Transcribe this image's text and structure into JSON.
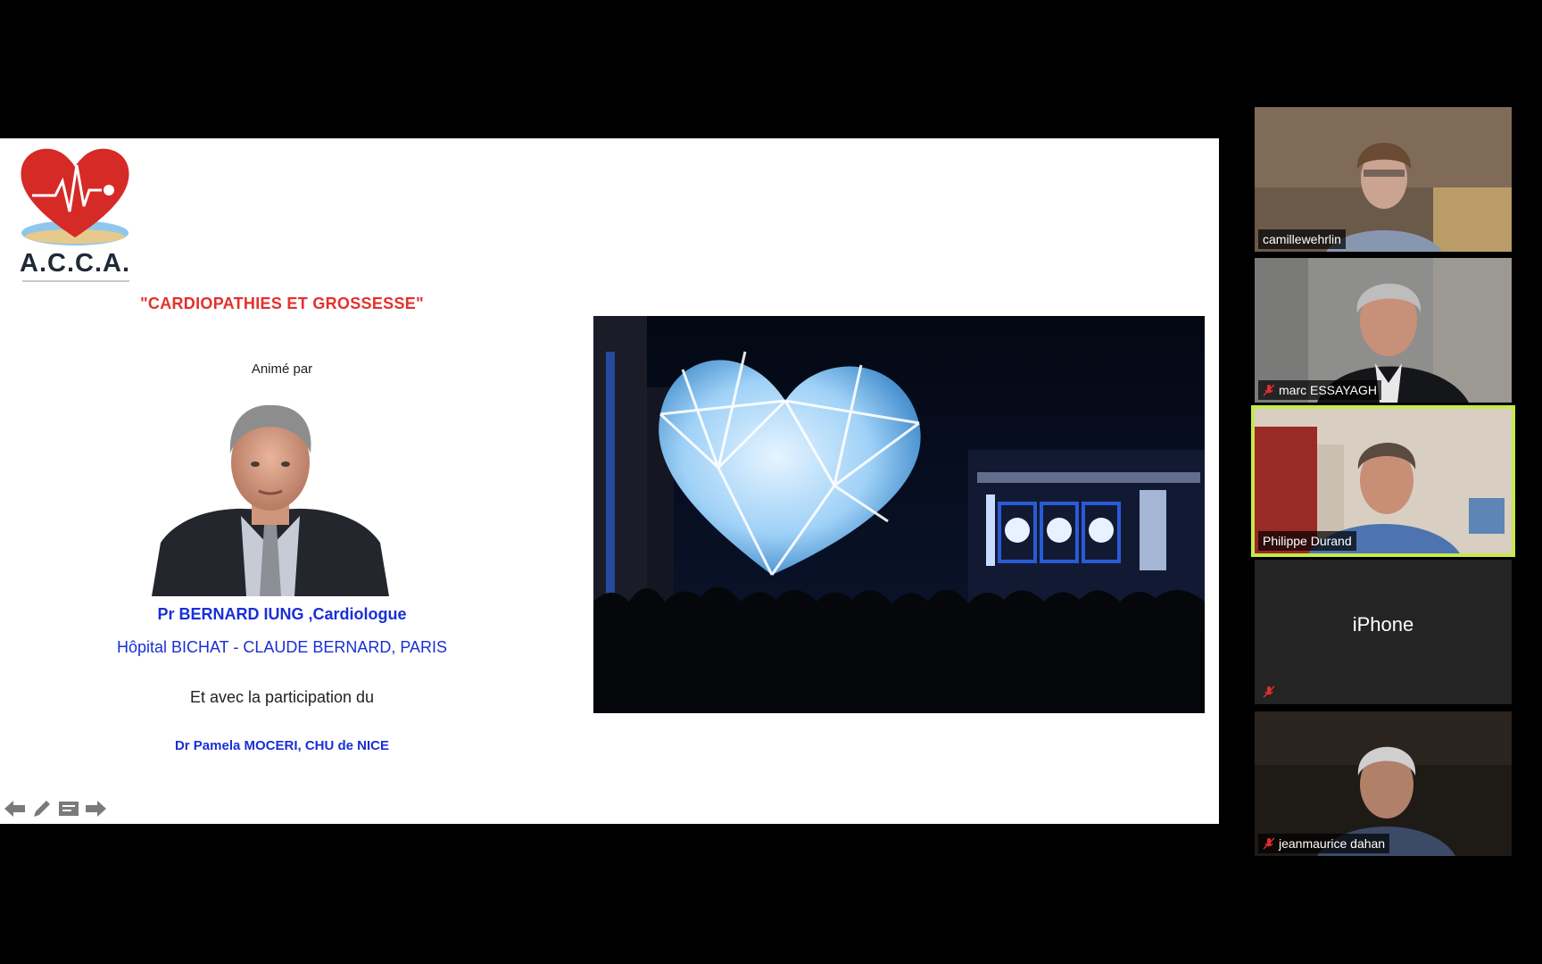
{
  "slide": {
    "logo_text": "A.C.C.A.",
    "title": "\"CARDIOPATHIES ET GROSSESSE\"",
    "anime_par": "Animé par",
    "speaker_name": "Pr BERNARD IUNG ,Cardiologue",
    "speaker_hospital": "Hôpital BICHAT  - CLAUDE BERNARD, PARIS",
    "participation": "Et avec la participation du",
    "participant_doctor": "Dr Pamela MOCERI, CHU de NICE"
  },
  "slide_tools": [
    {
      "name": "previous-slide",
      "icon": "arrow-left-icon"
    },
    {
      "name": "pen",
      "icon": "pencil-icon"
    },
    {
      "name": "notes",
      "icon": "notes-icon"
    },
    {
      "name": "next-slide",
      "icon": "arrow-right-icon"
    }
  ],
  "participants": [
    {
      "name": "camillewehrlin",
      "muted": false,
      "active": false,
      "video": true
    },
    {
      "name": "marc ESSAYAGH",
      "muted": true,
      "active": false,
      "video": true
    },
    {
      "name": "Philippe Durand",
      "muted": false,
      "active": true,
      "video": true
    },
    {
      "name": "iPhone",
      "muted": true,
      "active": false,
      "video": false
    },
    {
      "name": "jeanmaurice dahan",
      "muted": true,
      "active": false,
      "video": true
    }
  ],
  "colors": {
    "title_red": "#e3312d",
    "speaker_blue": "#1a2fd6",
    "active_speaker_border": "#c6e94a",
    "mute_red": "#e02e2e"
  }
}
